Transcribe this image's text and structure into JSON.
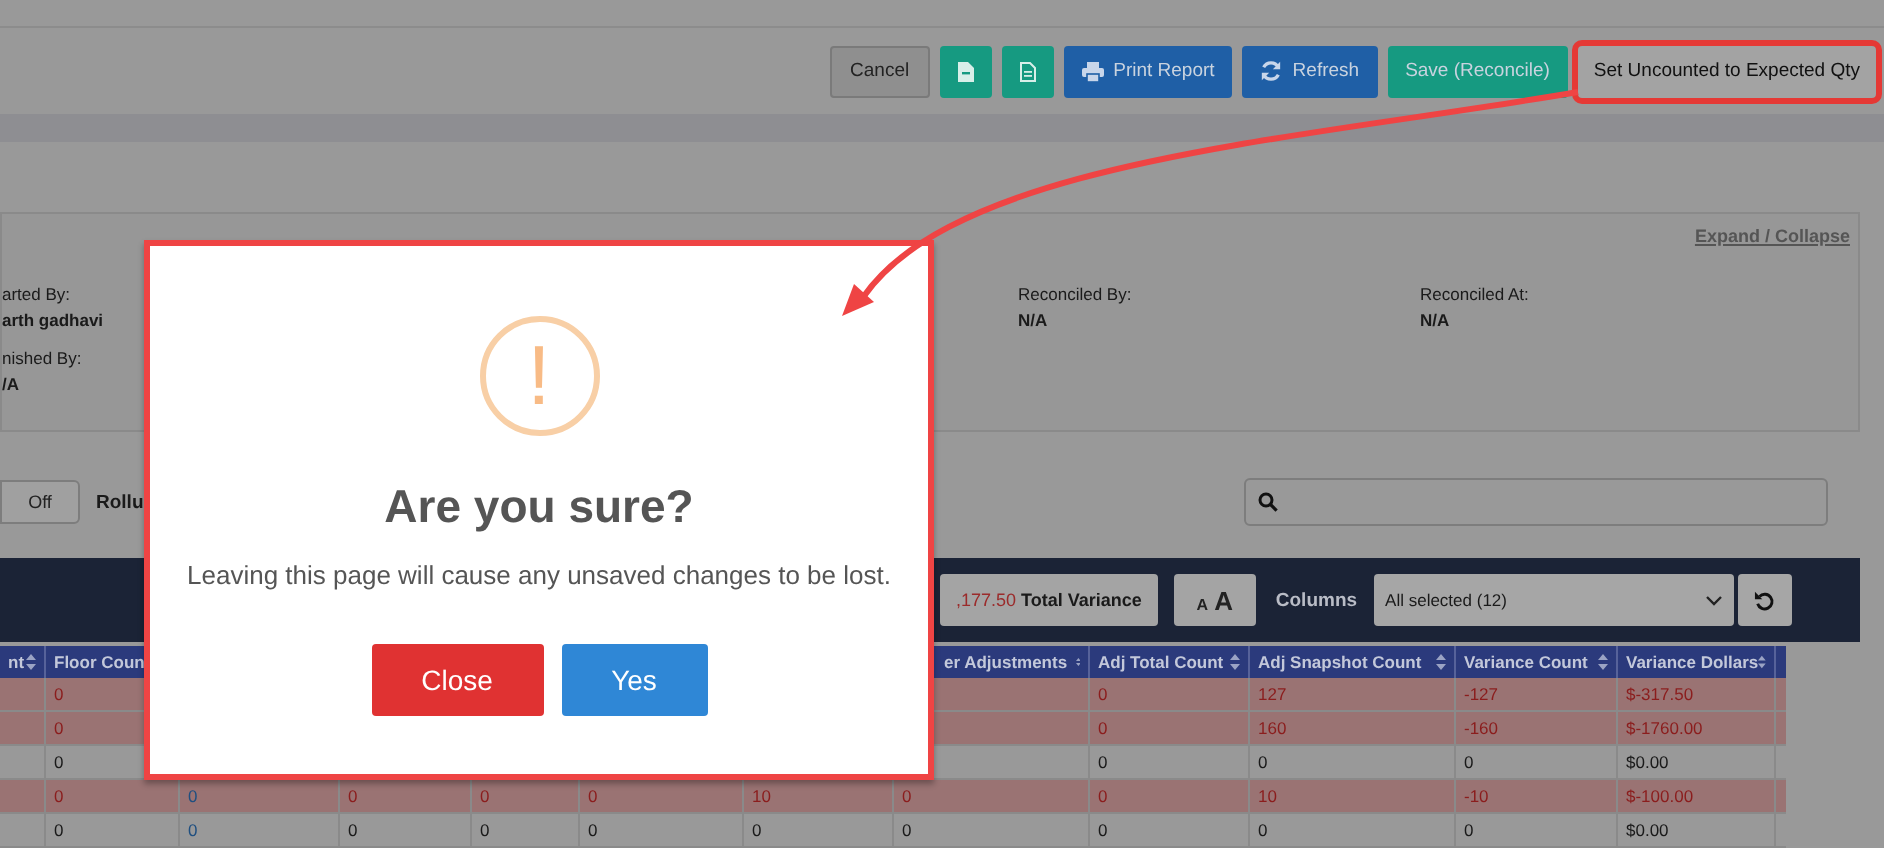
{
  "toolbar": {
    "buttons": [
      {
        "label": "Cancel",
        "kind": "plain",
        "color": "#8f8f8f",
        "annotated": false
      },
      {
        "kind": "file",
        "color": "#169a81",
        "annotated": false
      },
      {
        "kind": "doc",
        "color": "#169a81",
        "annotated": false
      },
      {
        "label": "Print Report",
        "kind": "print",
        "color": "#1f5fa6",
        "annotated": false
      },
      {
        "label": "Refresh",
        "kind": "refresh",
        "color": "#1f5fa6",
        "annotated": false
      },
      {
        "label": "Save (Reconcile)",
        "kind": "plain",
        "color": "#169a81",
        "annotated": false
      },
      {
        "label": "Set Uncounted to Expected Qty",
        "kind": "plain",
        "color": "#a3a3a3",
        "annotated": true
      }
    ]
  },
  "info": {
    "link": "Expand / Collapse",
    "columns": [
      {
        "fields": [
          {
            "label": "arted By:",
            "value": "arth gadhavi"
          },
          {
            "label": "nished By:",
            "value": "/A"
          }
        ]
      },
      {
        "fields": [
          {
            "label": "Reconciled By:",
            "value": "N/A"
          }
        ]
      },
      {
        "fields": [
          {
            "label": "Reconciled At:",
            "value": "N/A"
          }
        ]
      }
    ]
  },
  "controls": {
    "toggle": "Off",
    "label": "Rollu"
  },
  "table_toolbar": {
    "amount": ",177.50",
    "amount_label": "Total Variance",
    "font_small": "A",
    "font_large": "A",
    "columns_label": "Columns",
    "columns_select": "All selected (12)"
  },
  "table": {
    "columns": [
      {
        "label": "nt",
        "sort_icon": true
      },
      {
        "label": "Floor Coun"
      },
      {},
      {},
      {},
      {},
      {},
      {
        "label": "er Adjustments",
        "sort_icon": true
      },
      {
        "label": "Adj Total Count",
        "sort_icon": true
      },
      {
        "label": "Adj Snapshot Count",
        "sort_icon": true
      },
      {
        "label": "Variance Count",
        "sort_icon": true
      },
      {
        "label": "Variance Dollars",
        "sort_icon": true
      }
    ],
    "rows": [
      {
        "highlighted": true,
        "cells": [
          null,
          "0",
          null,
          null,
          null,
          null,
          null,
          null,
          "0",
          "127",
          "-127",
          "$-317.50"
        ]
      },
      {
        "highlighted": true,
        "cells": [
          null,
          "0",
          null,
          null,
          null,
          null,
          null,
          null,
          "0",
          "160",
          "-160",
          "$-1760.00"
        ]
      },
      {
        "highlighted": false,
        "cells": [
          null,
          "0",
          null,
          null,
          null,
          null,
          null,
          null,
          "0",
          "0",
          "0",
          "$0.00"
        ]
      },
      {
        "highlighted": true,
        "cells": [
          null,
          "0",
          "0",
          "0",
          "0",
          "0",
          "10",
          "0",
          "0",
          "10",
          "-10",
          "$-100.00"
        ]
      },
      {
        "highlighted": false,
        "cells": [
          null,
          "0",
          "0",
          "0",
          "0",
          "0",
          "0",
          "0",
          "0",
          "0",
          "0",
          "$0.00"
        ]
      }
    ]
  },
  "dialog": {
    "annotated": true,
    "symbol": "!",
    "title": "Are you sure?",
    "message": "Leaving this page will cause any unsaved changes to be lost.",
    "buttons": [
      {
        "label": "Close",
        "kind": "cancel"
      },
      {
        "label": "Yes",
        "kind": "confirm"
      }
    ]
  }
}
